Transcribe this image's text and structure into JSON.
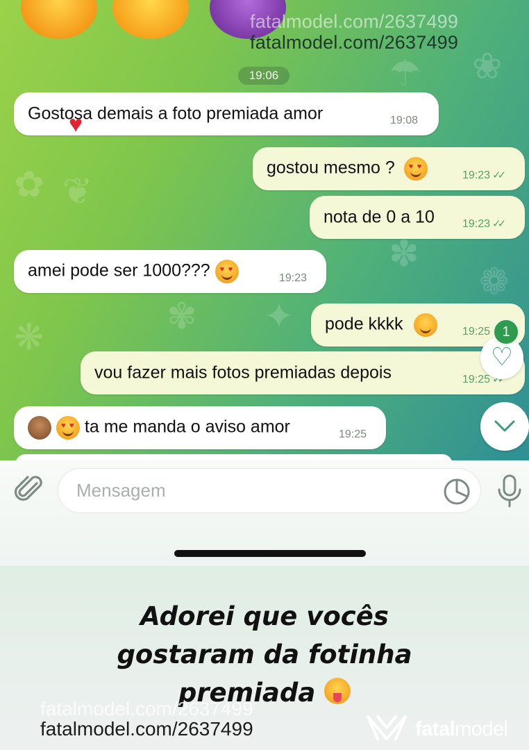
{
  "watermark": "fatalmodel.com/2637499",
  "brand": {
    "name": "fatalmodel",
    "name_bold": "fatal",
    "name_light": "model"
  },
  "chat": {
    "date_label": "19:06",
    "messages": [
      {
        "dir": "in",
        "text": "Gostosa demais a foto premiada amor",
        "time": "19:08"
      },
      {
        "dir": "out",
        "text": "gostou mesmo ?",
        "time": "19:23",
        "status": "read"
      },
      {
        "dir": "out",
        "text": "nota de 0 a 10",
        "time": "19:23",
        "status": "read"
      },
      {
        "dir": "in",
        "text": "amei pode ser 1000???",
        "time": "19:23"
      },
      {
        "dir": "out",
        "text": "pode kkkk",
        "time": "19:25",
        "status": "read"
      },
      {
        "dir": "out",
        "text": "vou fazer mais fotos premiadas depois",
        "time": "19:25",
        "status": "read"
      },
      {
        "dir": "in",
        "text": "ta me manda o aviso amor",
        "time": "19:25"
      }
    ],
    "reaction_badge_count": "1",
    "read_check": "✓✓"
  },
  "input": {
    "placeholder": "Mensagem"
  },
  "caption": {
    "line1": "Adorei que vocês",
    "line2": "gostaram da fotinha",
    "line3": "premiada"
  },
  "colors": {
    "in_bubble": "#ffffff",
    "out_bubble": "#f4f8d6",
    "accent": "#3e9a7f",
    "badge": "#2f9b4e"
  }
}
